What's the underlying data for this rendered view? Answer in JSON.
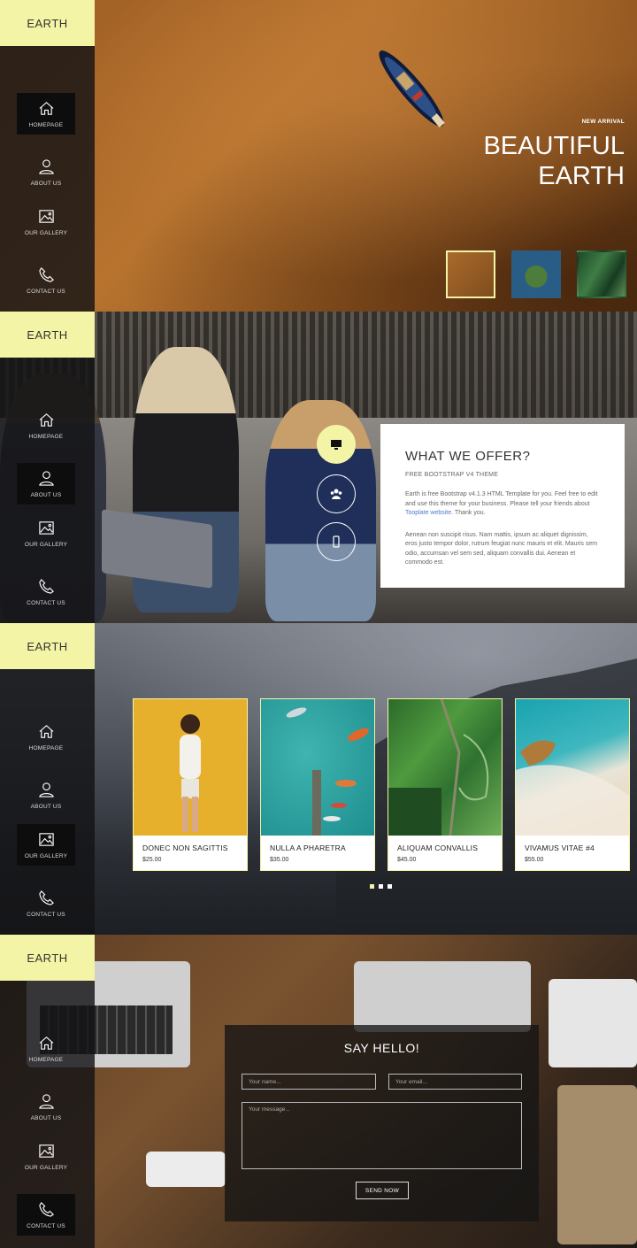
{
  "brand": "EARTH",
  "nav": [
    {
      "label": "HOMEPAGE",
      "icon": "home-icon"
    },
    {
      "label": "ABOUT US",
      "icon": "user-icon"
    },
    {
      "label": "OUR GALLERY",
      "icon": "image-icon"
    },
    {
      "label": "CONTACT US",
      "icon": "phone-icon"
    }
  ],
  "hero": {
    "kicker": "NEW ARRIVAL",
    "title_line1": "BEAUTIFUL",
    "title_line2": "EARTH"
  },
  "offer": {
    "title": "WHAT WE OFFER?",
    "subtitle": "FREE BOOTSTRAP V4 THEME",
    "p1_before": "Earth is free Bootstrap v4.1.3 HTML Template for you. Feel free to edit and use this theme for your business. Please tell your friends about ",
    "p1_link": "Tooplate website",
    "p1_after": ". Thank you.",
    "p2": "Aenean non suscipit risus. Nam mattis, ipsum ac aliquet dignissim, eros justo tempor dolor, rutrum feugiat nunc mauris et elit. Mauris sem odio, accumsan vel sem sed, aliquam convallis dui. Aenean et commodo est."
  },
  "gallery": {
    "items": [
      {
        "title": "DONEC NON SAGITTIS",
        "price": "$25.00"
      },
      {
        "title": "NULLA A PHARETRA",
        "price": "$35.00"
      },
      {
        "title": "ALIQUAM CONVALLIS",
        "price": "$45.00"
      },
      {
        "title": "VIVAMUS VITAE #4",
        "price": "$55.00"
      }
    ]
  },
  "contact": {
    "title": "SAY HELLO!",
    "name_placeholder": "Your name...",
    "email_placeholder": "Your email...",
    "message_placeholder": "Your message...",
    "send_label": "SEND NOW"
  },
  "colors": {
    "accent": "#f4f4a6",
    "sidebar": "#141416"
  }
}
